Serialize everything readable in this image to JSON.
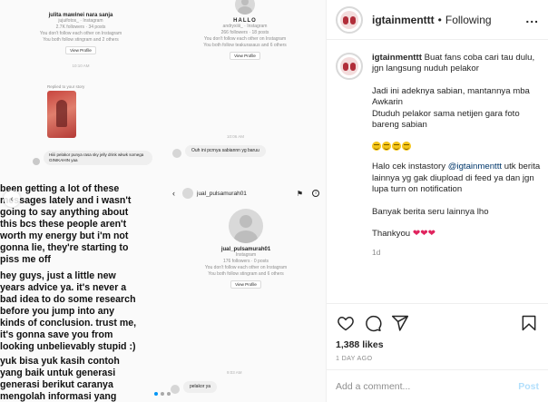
{
  "media": {
    "tl_name": "julita mawinei nara sanja",
    "tl_handle": "jujuifotos_ · Instagram",
    "tl_stats": "2.7K followers · 34 posts",
    "tl_line1": "You don't follow each other on Instagram",
    "tl_line2": "You both follow stingram and 2 others",
    "tl_btn": "View Profile",
    "tl_time": "10:10 AM",
    "tr_name": "HALLO",
    "tr_handle": "andryxiiii_ · Instagram",
    "tr_stats": "266 followers · 18 posts",
    "tr_line1": "You don't follow each other on Instagram",
    "tr_line2": "You both follow teakurasaus and 6 others",
    "tr_btn": "View Profile",
    "story_reply_label": "Replied to your story",
    "story_caption": "Hiiii pelakor punya rasa sky jelly drink wkwk somega GINIKAHIN yaa",
    "chat_time": "10:06 AM",
    "chat_msg": "Ouh ini pcrnya sabiannn yg baruu",
    "big_text_1": "been getting a lot of these\nmessages lately and i wasn't\ngoing to say anything about\nthis bcs these people aren't\nworth my energy but i'm not\ngonna lie, they're starting to\npiss me off",
    "big_text_2": "hey guys, just a little new\nyears advice ya. it's never a\nbad idea to do some research\nbefore you jump into any\nkinds of conclusion. trust me,\nit's gonna save you from\nlooking unbelievably stupid :)",
    "big_text_3": "yuk bisa yuk kasih contoh\nyang baik untuk generasi\ngenerasi berikut caranya\nmengolah informasi yang",
    "dm_user": "jual_pulsamurah01",
    "dm_name": "jual_pulsamurah01",
    "dm_sub": "Instagram",
    "dm_stats": "176 followers · 0 posts",
    "dm_line1": "You don't follow each other on Instagram",
    "dm_line2": "You both follow stingram and 6 others",
    "dm_btn": "View Profile",
    "dm_time": "9:03 AM",
    "dm_msg": "pelakor ya"
  },
  "header": {
    "username": "igtainmenttt",
    "separator": "•",
    "follow_status": "Following",
    "more": "..."
  },
  "caption": {
    "username": "igtainmenttt",
    "p1": "Buat fans coba cari tau dulu, jgn langsung nuduh pelakor",
    "p2": "Jadi ini adeknya sabian, mantannya mba Awkarin\nDtuduh pelakor sama netijen gara foto bareng sabian",
    "p4_prefix": "Halo cek instastory ",
    "p4_mention": "@igtainmenttt",
    "p4_suffix": " utk berita lainnya yg gak diupload di feed ya dan jgn lupa turn on notification",
    "p5": "Banyak berita seru lainnya lho",
    "p6": "Thankyou",
    "time": "1d"
  },
  "actions": {
    "likes": "1,388 likes",
    "date": "1 DAY AGO"
  },
  "comment": {
    "placeholder": "Add a comment...",
    "post": "Post"
  },
  "colors": {
    "link": "#00376b",
    "post_disabled": "#b2dffc",
    "heart": "#e0245e",
    "carousel_active": "#0095f6"
  }
}
